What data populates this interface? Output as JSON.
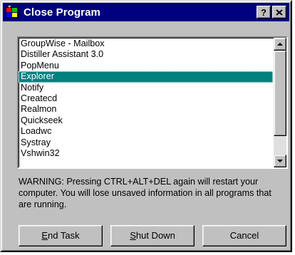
{
  "window": {
    "title": "Close Program",
    "icon": "close-program-app-icon",
    "help_button": "?",
    "close_button": "X"
  },
  "colors": {
    "titlebar": "#000080",
    "selection": "#008080",
    "face": "#c0c0c0"
  },
  "program_list": {
    "items": [
      "GroupWise - Mailbox",
      "Distiller Assistant 3.0",
      "PopMenu",
      "Explorer",
      "Notify",
      "Createcd",
      "Realmon",
      "Quickseek",
      "Loadwc",
      "Systray",
      "Vshwin32"
    ],
    "selected": "Explorer"
  },
  "warning_text": "WARNING: Pressing CTRL+ALT+DEL again will restart your computer. You will lose unsaved information in all programs that are running.",
  "buttons": {
    "end_task": {
      "mnemonic": "E",
      "rest": "nd Task"
    },
    "shut_down": {
      "mnemonic": "S",
      "rest": "hut Down"
    },
    "cancel": "Cancel"
  }
}
